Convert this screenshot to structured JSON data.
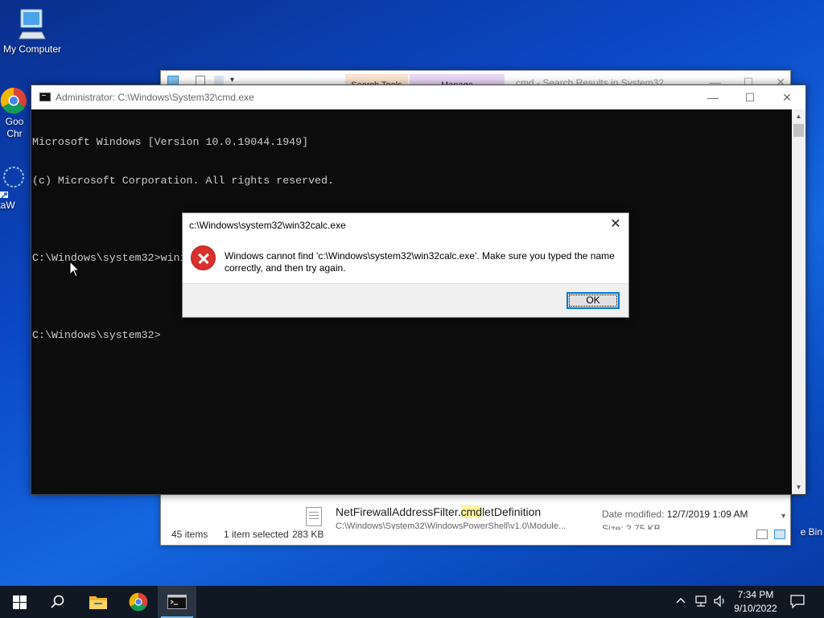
{
  "desktop": {
    "icons": [
      {
        "label": "My Computer"
      },
      {
        "label": "Goo"
      },
      {
        "label": "Chr"
      },
      {
        "label": "DataW"
      }
    ],
    "recycle_bin_label": "e Bin"
  },
  "explorer": {
    "tab_search_tools": "Search Tools",
    "tab_manage": "Manage",
    "title": "cmd - Search Results in System32",
    "file_name_pre": "NetFirewallAddressFilter.",
    "file_name_mark": "cmd",
    "file_name_post": "letDefinition",
    "file_path": "C:\\Windows\\System32\\WindowsPowerShell\\v1.0\\Module...",
    "date_modified_label": "Date modified:",
    "date_modified_value": "12/7/2019 1:09 AM",
    "size_label": "Size:",
    "size_value": "2.75 KB",
    "status_items": "45 items",
    "status_selected": "1 item selected",
    "status_size": "283 KB"
  },
  "cmd": {
    "title": "Administrator: C:\\Windows\\System32\\cmd.exe",
    "minimize": "—",
    "maximize": "☐",
    "close": "✕",
    "lines": [
      "Microsoft Windows [Version 10.0.19044.1949]",
      "(c) Microsoft Corporation. All rights reserved.",
      "",
      "C:\\Windows\\system32>wininit",
      "",
      "C:\\Windows\\system32>"
    ]
  },
  "dialog": {
    "title": "c:\\Windows\\system32\\win32calc.exe",
    "close": "✕",
    "message": "Windows cannot find 'c:\\Windows\\system32\\win32calc.exe'. Make sure you typed the name correctly, and then try again.",
    "ok_label": "OK"
  },
  "taskbar": {
    "time": "7:34 PM",
    "date": "9/10/2022"
  },
  "colors": {
    "error_red": "#d8302c",
    "accent_blue": "#0078d7",
    "console_bg": "#0c0c0c",
    "console_fg": "#cccccc"
  }
}
